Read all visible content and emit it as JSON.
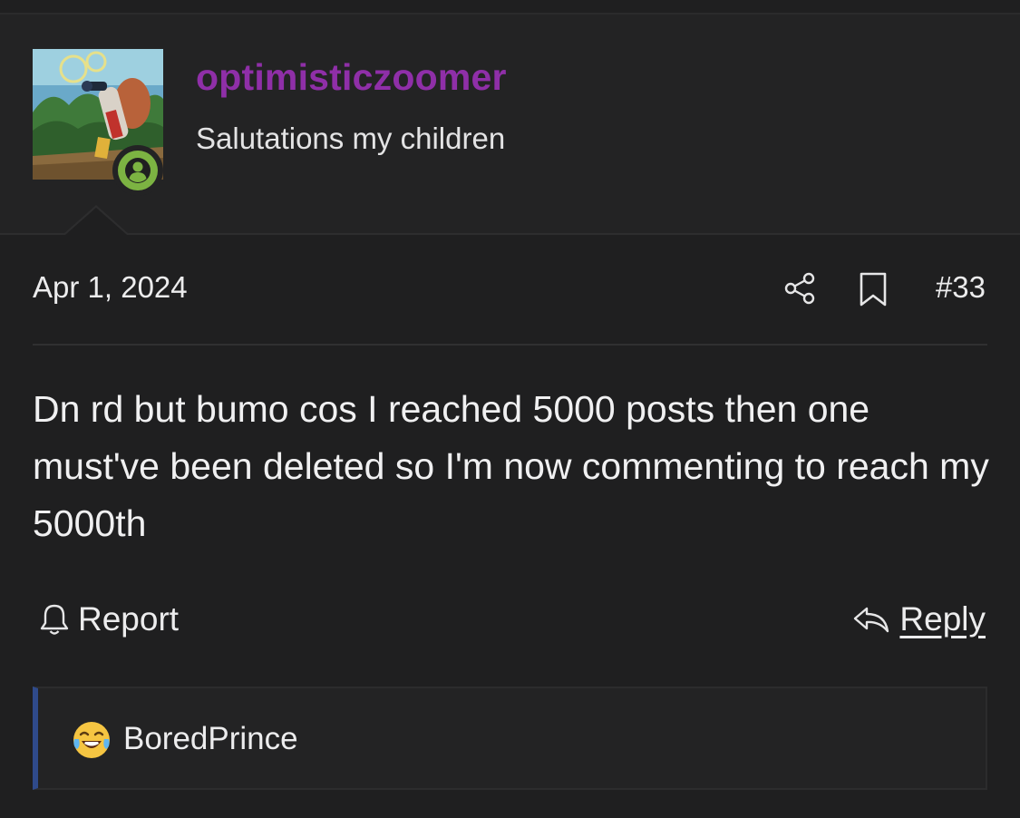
{
  "user": {
    "username": "optimisticzoomer",
    "title": "Salutations my children",
    "online": true
  },
  "post": {
    "date": "Apr 1, 2024",
    "number": "#33",
    "body": "Dn rd but bumo cos I reached 5000 posts then one must've been deleted so I'm now commenting to reach my 5000th"
  },
  "actions": {
    "report_label": "Report",
    "reply_label": "Reply"
  },
  "reactions": {
    "emoji_icon": "laughing-crying-emoji",
    "user": "BoredPrince"
  },
  "colors": {
    "username": "#8f2fa8",
    "online": "#7cb342",
    "reaction_accent": "#2f4a8a"
  }
}
